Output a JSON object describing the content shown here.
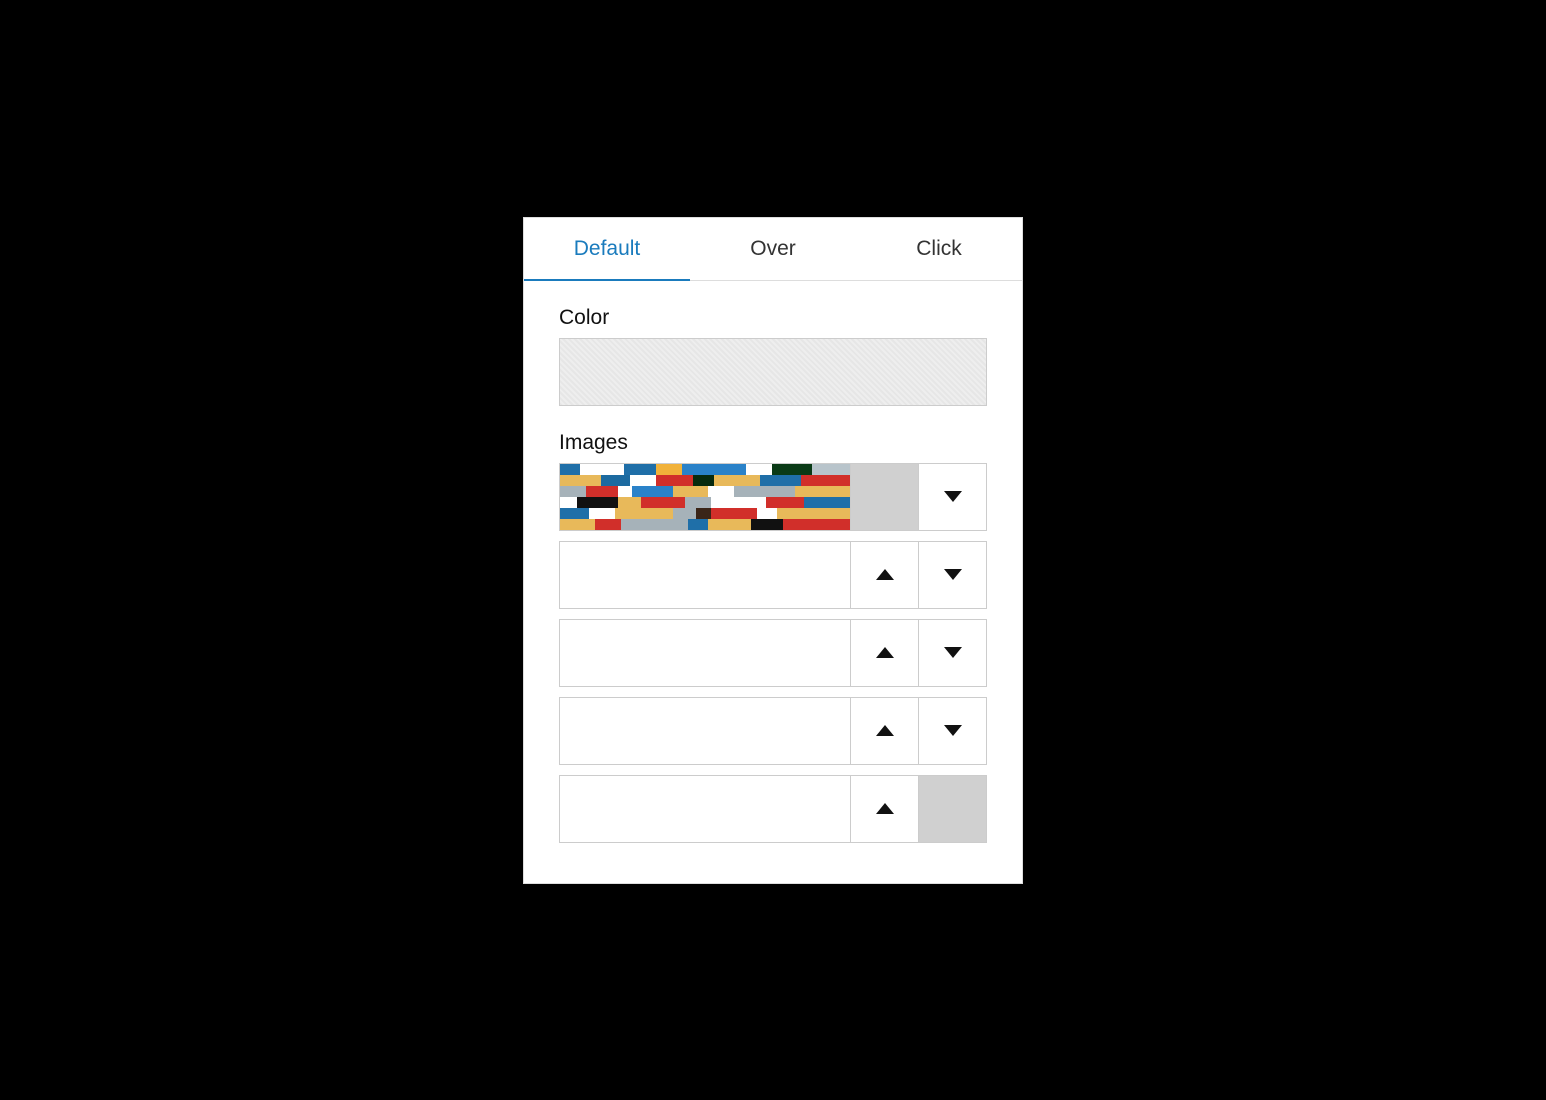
{
  "tabs": [
    {
      "label": "Default",
      "active": true
    },
    {
      "label": "Over",
      "active": false
    },
    {
      "label": "Click",
      "active": false
    }
  ],
  "sections": {
    "color_label": "Color",
    "images_label": "Images"
  },
  "images": [
    {
      "has_image": true,
      "up_enabled": false,
      "down_enabled": true,
      "show_upload": true
    },
    {
      "has_image": false,
      "up_enabled": true,
      "down_enabled": true,
      "show_upload": false
    },
    {
      "has_image": false,
      "up_enabled": true,
      "down_enabled": true,
      "show_upload": false
    },
    {
      "has_image": false,
      "up_enabled": true,
      "down_enabled": true,
      "show_upload": false
    },
    {
      "has_image": false,
      "up_enabled": true,
      "down_enabled": false,
      "show_upload": false
    }
  ],
  "colors": {
    "accent": "#1a7bbd"
  }
}
